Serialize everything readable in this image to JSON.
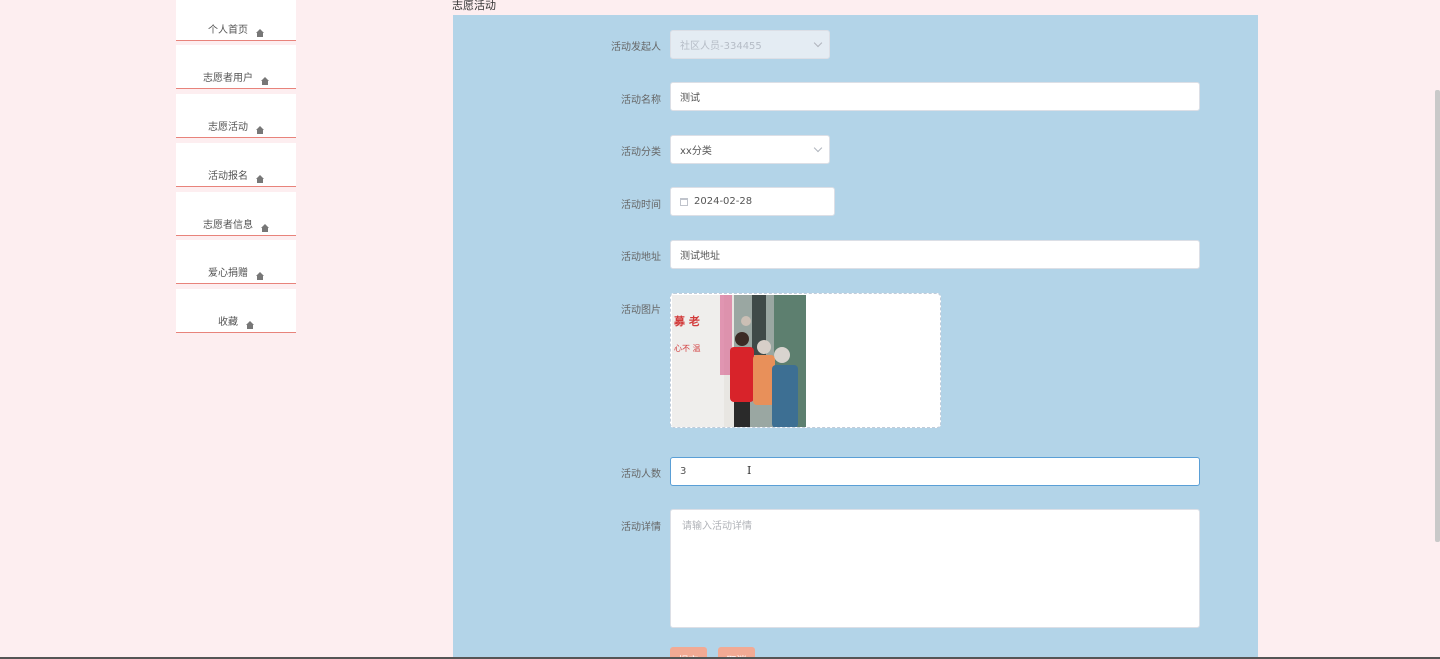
{
  "page": {
    "title": "志愿活动"
  },
  "sidebar": {
    "items": [
      {
        "label": "个人首页",
        "icon": "home-icon"
      },
      {
        "label": "志愿者用户",
        "icon": "home-icon"
      },
      {
        "label": "志愿活动",
        "icon": "home-icon"
      },
      {
        "label": "活动报名",
        "icon": "home-icon"
      },
      {
        "label": "志愿者信息",
        "icon": "home-icon"
      },
      {
        "label": "爱心捐赠",
        "icon": "home-icon"
      },
      {
        "label": "收藏",
        "icon": "home-icon"
      }
    ]
  },
  "form": {
    "initiator": {
      "label": "活动发起人",
      "value": "社区人员-334455"
    },
    "name": {
      "label": "活动名称",
      "value": "测试"
    },
    "category": {
      "label": "活动分类",
      "value": "xx分类"
    },
    "time": {
      "label": "活动时间",
      "value": "2024-02-28"
    },
    "address": {
      "label": "活动地址",
      "value": "测试地址"
    },
    "photo": {
      "label": "活动图片",
      "alt": "活动图片"
    },
    "count": {
      "label": "活动人数",
      "value": "3"
    },
    "detail": {
      "label": "活动详情",
      "placeholder": "请输入活动详情"
    }
  },
  "buttons": {
    "submit": "提交",
    "cancel": "取消"
  },
  "colors": {
    "background": "#fdeef0",
    "panel": "#b3d4e8",
    "accent": "#e8837b",
    "button": "#f2aa94"
  }
}
